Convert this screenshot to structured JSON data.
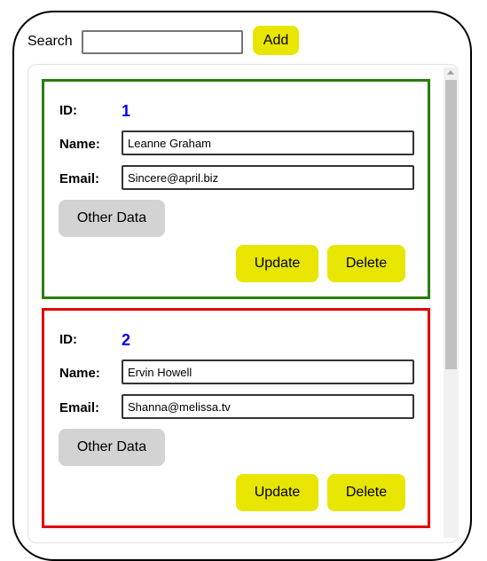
{
  "search": {
    "label": "Search",
    "value": "",
    "placeholder": ""
  },
  "toolbar": {
    "add_label": "Add"
  },
  "labels": {
    "id": "ID:",
    "name": "Name:",
    "email": "Email:"
  },
  "buttons": {
    "other_data": "Other Data",
    "update": "Update",
    "delete": "Delete"
  },
  "users": [
    {
      "id": "1",
      "name": "Leanne Graham",
      "email": "Sincere@april.biz",
      "border_color": "#2a7d00"
    },
    {
      "id": "2",
      "name": "Ervin Howell",
      "email": "Shanna@melissa.tv",
      "border_color": "#e00000"
    }
  ],
  "colors": {
    "accent": "#e8e500",
    "id_text": "#0000ee",
    "secondary_button": "#d3d3d3"
  }
}
